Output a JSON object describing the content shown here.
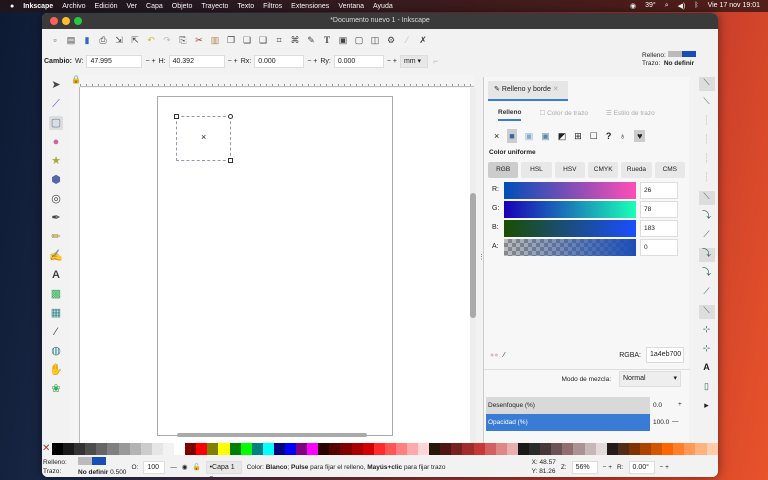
{
  "menubar": {
    "app": "Inkscape",
    "items": [
      "Archivo",
      "Edición",
      "Ver",
      "Capa",
      "Objeto",
      "Trayecto",
      "Texto",
      "Filtros",
      "Extensiones",
      "Ventana",
      "Ayuda"
    ],
    "battery": "39°",
    "clock": "Vie 17 nov 19:01"
  },
  "window": {
    "title": "*Documento nuevo 1 - Inkscape"
  },
  "toolbar": {
    "label": "Cambio:",
    "w_label": "W:",
    "w": "47.995",
    "h_label": "H:",
    "h": "40.392",
    "rx_label": "Rx:",
    "rx": "0.000",
    "ry_label": "Ry:",
    "ry": "0.000",
    "unit": "mm",
    "fill_label": "Relleno:",
    "stroke_label": "Trazo:",
    "stroke_value": "No definir"
  },
  "panel": {
    "tab": "Relleno y borde",
    "subtabs": [
      "Relleno",
      "Color de trazo",
      "Estilo de trazo"
    ],
    "mode_label": "Color uniforme",
    "color_tabs": [
      "RGB",
      "HSL",
      "HSV",
      "CMYK",
      "Rueda",
      "CMS"
    ],
    "channels": [
      {
        "label": "R:",
        "value": "26"
      },
      {
        "label": "G:",
        "value": "78"
      },
      {
        "label": "B:",
        "value": "183"
      },
      {
        "label": "A:",
        "value": "0"
      }
    ],
    "rgba_label": "RGBA:",
    "rgba": "1a4eb700",
    "blend_label": "Modo de mezcla:",
    "blend": "Normal",
    "blur_label": "Desenfoque (%)",
    "blur": "0.0",
    "opacity_label": "Opacidad (%)",
    "opacity": "100.0"
  },
  "status": {
    "fill_label": "Relleno:",
    "stroke_label": "Trazo:",
    "stroke_value": "No definir",
    "stroke_width": "0.500",
    "o_label": "O:",
    "opacity": "100",
    "layer": "•Capa 1",
    "message_pre": "Color: ",
    "msg_b1": "Blanco",
    "msg_mid": "; ",
    "msg_b2": "Pulse",
    "msg_mid2": " para fijar el relleno, ",
    "msg_b3": "Mayús+clic",
    "msg_end": " para fijar trazo",
    "x_label": "X:",
    "x": "48.57",
    "y_label": "Y:",
    "y": "81.26",
    "z_label": "Z:",
    "zoom": "56%",
    "r_label": "R:",
    "rotation": "0.00°"
  },
  "colors": {
    "fill": "#1a4eb7",
    "accent": "#3a7bd5",
    "palette": [
      "#000",
      "#1a1a1a",
      "#333",
      "#4d4d4d",
      "#666",
      "#808080",
      "#999",
      "#b3b3b3",
      "#ccc",
      "#e6e6e6",
      "#f2f2f2",
      "#fff",
      "#800000",
      "#f00",
      "#808000",
      "#ff0",
      "#008000",
      "#0f0",
      "#008080",
      "#0ff",
      "#000080",
      "#00f",
      "#800080",
      "#f0f",
      "#2b0000",
      "#550000",
      "#800000",
      "#aa0000",
      "#d40000",
      "#ff2a2a",
      "#ff5555",
      "#ff8080",
      "#ffaaaa",
      "#ffd5d5",
      "#28170b",
      "#501616",
      "#782121",
      "#a02c2c",
      "#c83737",
      "#d35f5f",
      "#de8787",
      "#e9afaf",
      "#1a1a1a",
      "#2b2b2b",
      "#483737",
      "#6c5353",
      "#916f6f",
      "#ac9393",
      "#c8b7b7",
      "#e3dbdb",
      "#241c1c",
      "#502d16",
      "#803300",
      "#aa4400",
      "#d45500",
      "#ff6600",
      "#ff7f2a",
      "#ff9955",
      "#ffb380",
      "#ffccaa"
    ]
  }
}
